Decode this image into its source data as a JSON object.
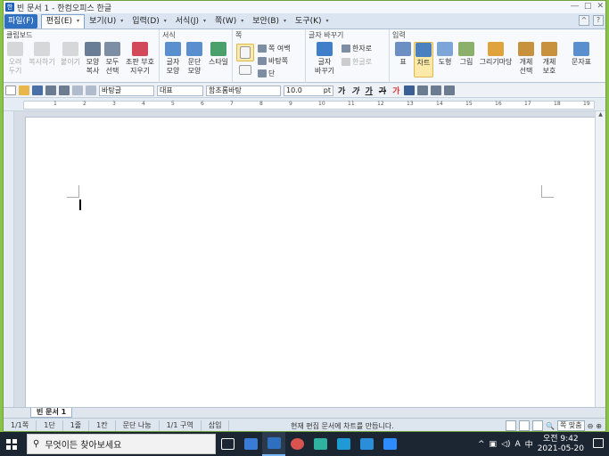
{
  "window": {
    "title": "빈 문서 1 - 한컴오피스 한글",
    "controls": [
      "―",
      "□",
      "✕"
    ]
  },
  "menu": {
    "file": "파일(F)",
    "items": [
      "편집(E)",
      "보기(U)",
      "입력(D)",
      "서식(J)",
      "쪽(W)",
      "보안(B)",
      "도구(K)"
    ]
  },
  "ribbon": {
    "clipboard": {
      "label": "클립보드",
      "cut": [
        "오려",
        "두기"
      ],
      "copy": "복사하기",
      "paste": "붙이기",
      "shape_copy": [
        "모양",
        "복사"
      ],
      "select_all": [
        "모두",
        "선택"
      ],
      "clear": [
        "조판 부호",
        "지우기"
      ]
    },
    "format": {
      "label": "서식",
      "char_shape": [
        "글자",
        "모양"
      ],
      "para_shape": [
        "문단",
        "모양"
      ],
      "style": "스타일"
    },
    "page": {
      "label": "쪽",
      "margin": "쪽 여백",
      "background": "바탕쪽",
      "column": "단"
    },
    "charchange": {
      "label": "글자 바꾸기",
      "hanja": "한자로",
      "hangul": "한글로",
      "change": [
        "글자",
        "바꾸기"
      ]
    },
    "insert": {
      "label": "입력",
      "table": "표",
      "chart": "차트",
      "shape": "도형",
      "picture": "그림",
      "clipart": "그리기마당",
      "obj_select": [
        "개체",
        "선택"
      ],
      "obj_protect": [
        "개체",
        "보호"
      ],
      "symbol": "문자표"
    }
  },
  "toolbar": {
    "style": "바탕글",
    "lang": "대표",
    "font": "함초롬바탕",
    "size": "10.0",
    "unit": "pt",
    "bold": "가",
    "italic": "가",
    "underline": "가",
    "strike": "가",
    "color": "가"
  },
  "ruler": {
    "marks": [
      "1",
      "2",
      "3",
      "4",
      "5",
      "6",
      "7",
      "8",
      "9",
      "10",
      "11",
      "12",
      "13",
      "14",
      "15",
      "16",
      "17",
      "18",
      "19"
    ]
  },
  "tabbar": {
    "doc_tab": "빈 문서 1"
  },
  "status": {
    "page": "1/1쪽",
    "section": "1단",
    "line": "1줄",
    "column": "1칸",
    "mode": "문단 나눔",
    "area": "1/1 구역",
    "insert": "삽입",
    "message": "현재 편집 문서에 차트를 만듭니다.",
    "zoom": "쪽 맞춤"
  },
  "taskbar": {
    "search_placeholder": "무엇이든 찾아보세요",
    "time": "오전 9:42",
    "date": "2021-05-20",
    "ime": "A",
    "ime2": "中"
  },
  "colors": {
    "accent": "#2f6fc0",
    "desktop_border": "#8bc34a",
    "taskbar": "#1c2532"
  }
}
